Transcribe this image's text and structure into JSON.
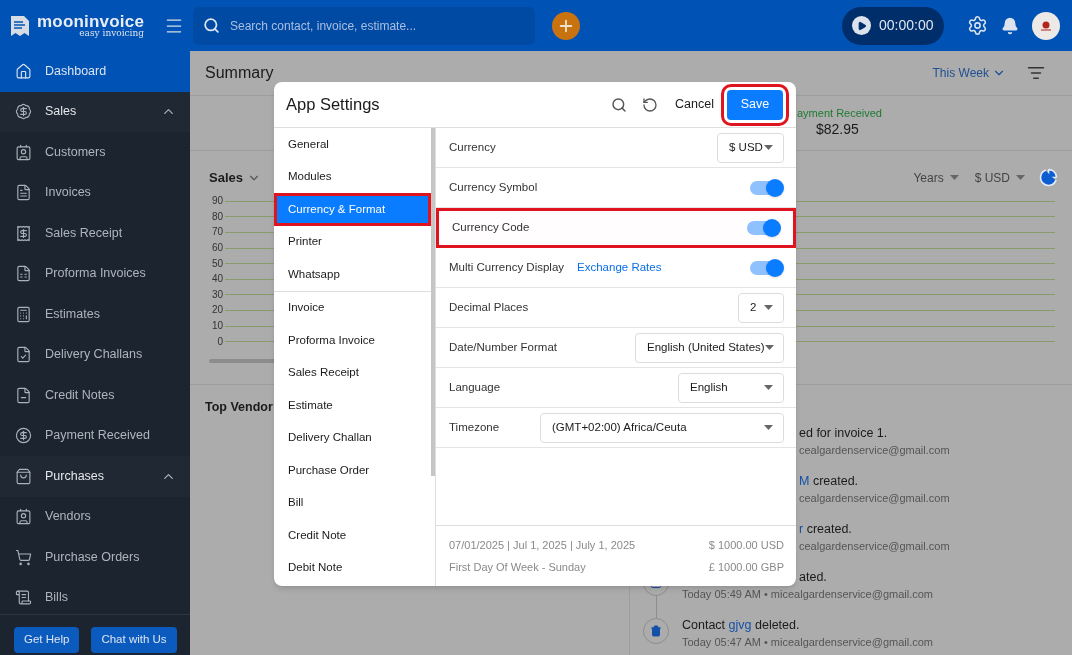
{
  "header": {
    "brand": "mooninvoice",
    "tagline": "easy invoicing",
    "search": {
      "placeholder": "Search contact, invoice, estimate..."
    },
    "timer": "00:00:00"
  },
  "sidebar": {
    "items": [
      {
        "kind": "link",
        "label": "Dashboard",
        "selected": true
      },
      {
        "kind": "section",
        "label": "Sales",
        "expanded": true,
        "selected": false
      },
      {
        "kind": "link",
        "label": "Customers",
        "selected": false
      },
      {
        "kind": "link",
        "label": "Invoices",
        "selected": false
      },
      {
        "kind": "link",
        "label": "Sales Receipt",
        "selected": false
      },
      {
        "kind": "link",
        "label": "Proforma Invoices",
        "selected": false
      },
      {
        "kind": "link",
        "label": "Estimates",
        "selected": false
      },
      {
        "kind": "link",
        "label": "Delivery Challans",
        "selected": false
      },
      {
        "kind": "link",
        "label": "Credit Notes",
        "selected": false
      },
      {
        "kind": "link",
        "label": "Payment Received",
        "selected": false
      },
      {
        "kind": "section",
        "label": "Purchases",
        "expanded": true,
        "selected": false
      },
      {
        "kind": "link",
        "label": "Vendors",
        "selected": false
      },
      {
        "kind": "link",
        "label": "Purchase Orders",
        "selected": false
      },
      {
        "kind": "link",
        "label": "Bills",
        "selected": false
      }
    ],
    "buttons": [
      "Get Help",
      "Chat with Us"
    ]
  },
  "summary": {
    "title": "Summary",
    "period": "This Week",
    "card": {
      "label": "ayment Received",
      "amount": "$82.95"
    }
  },
  "sales_chart": {
    "title": "Sales",
    "range": "Years",
    "currency": "$ USD",
    "y_ticks": [
      "90",
      "80",
      "70",
      "60",
      "50",
      "40",
      "30",
      "20",
      "10",
      "0"
    ]
  },
  "top_vendors": {
    "title": "Top Vendor"
  },
  "activity": [
    {
      "text": "ed for invoice 1.",
      "meta": "cealgardenservice@gmail.com"
    },
    {
      "link": "M",
      "text": " created.",
      "meta": "cealgardenservice@gmail.com"
    },
    {
      "link": "r",
      "text": " created.",
      "meta": "cealgardenservice@gmail.com"
    },
    {
      "text": "ated.",
      "meta": "Today 05:49 AM • micealgardenservice@gmail.com"
    },
    {
      "prefix": "Contact ",
      "link": "gjvg",
      "text": " deleted.",
      "meta": "Today 05:47 AM • micealgardenservice@gmail.com"
    }
  ],
  "dialog": {
    "title": "App Settings",
    "cancel": "Cancel",
    "save": {
      "label": "Save",
      "highlighted": true
    },
    "nav_groups": [
      [
        {
          "label": "General",
          "selected": false,
          "highlighted": false
        },
        {
          "label": "Modules",
          "selected": false,
          "highlighted": false
        },
        {
          "label": "Currency & Format",
          "selected": true,
          "highlighted": true
        },
        {
          "label": "Printer",
          "selected": false,
          "highlighted": false
        },
        {
          "label": "Whatsapp",
          "selected": false,
          "highlighted": false
        }
      ],
      [
        {
          "label": "Invoice",
          "selected": false,
          "highlighted": false
        },
        {
          "label": "Proforma Invoice",
          "selected": false,
          "highlighted": false
        },
        {
          "label": "Sales Receipt",
          "selected": false,
          "highlighted": false
        },
        {
          "label": "Estimate",
          "selected": false,
          "highlighted": false
        },
        {
          "label": "Delivery Challan",
          "selected": false,
          "highlighted": false
        },
        {
          "label": "Purchase Order",
          "selected": false,
          "highlighted": false
        },
        {
          "label": "Bill",
          "selected": false,
          "highlighted": false
        },
        {
          "label": "Credit Note",
          "selected": false,
          "highlighted": false
        },
        {
          "label": "Debit Note",
          "selected": false,
          "highlighted": false
        }
      ]
    ],
    "rows": [
      {
        "kind": "select",
        "label": "Currency",
        "value": "$ USD",
        "highlighted": false
      },
      {
        "kind": "toggle",
        "label": "Currency Symbol",
        "on": true,
        "highlighted": false
      },
      {
        "kind": "toggle",
        "label": "Currency Code",
        "on": true,
        "highlighted": true
      },
      {
        "kind": "toggle",
        "label": "Multi Currency Display",
        "link": "Exchange Rates",
        "on": true,
        "highlighted": false
      },
      {
        "kind": "select",
        "label": "Decimal Places",
        "value": "2",
        "highlighted": false
      },
      {
        "kind": "select",
        "label": "Date/Number Format",
        "value": "English (United States)",
        "highlighted": false
      },
      {
        "kind": "select",
        "label": "Language",
        "value": "English",
        "highlighted": false
      },
      {
        "kind": "select",
        "label": "Timezone",
        "value": "(GMT+02:00) Africa/Ceuta",
        "highlighted": false
      }
    ],
    "footer": {
      "date_preview": "07/01/2025 | Jul 1, 2025 | July 1, 2025",
      "week_start": "First Day Of Week - Sunday",
      "amount_primary": "$ 1000.00 USD",
      "amount_secondary": "£ 1000.00 GBP"
    }
  }
}
